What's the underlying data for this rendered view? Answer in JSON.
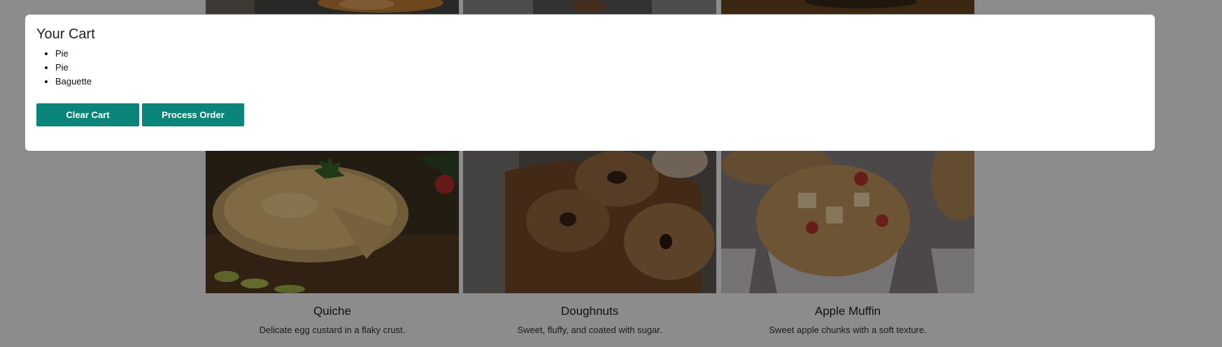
{
  "cart": {
    "title": "Your Cart",
    "items": [
      "Pie",
      "Pie",
      "Baguette"
    ],
    "clear_label": "Clear Cart",
    "process_label": "Process Order"
  },
  "products": [
    {
      "name": "Quiche",
      "description": "Delicate egg custard in a flaky crust.",
      "icon": "quiche-image"
    },
    {
      "name": "Doughnuts",
      "description": "Sweet, fluffy, and coated with sugar.",
      "icon": "doughnuts-image"
    },
    {
      "name": "Apple Muffin",
      "description": "Sweet apple chunks with a soft texture.",
      "icon": "apple-muffin-image"
    }
  ],
  "colors": {
    "accent": "#0b8579",
    "overlay": "rgba(0,0,0,0.45)"
  }
}
